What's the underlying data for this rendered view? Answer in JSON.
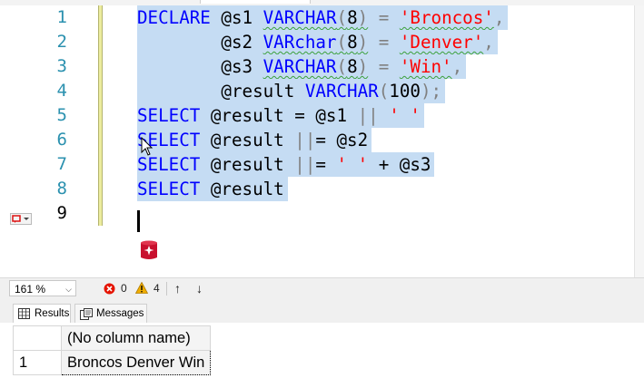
{
  "editor": {
    "lines": [
      {
        "num": "1"
      },
      {
        "num": "2"
      },
      {
        "num": "3"
      },
      {
        "num": "4"
      },
      {
        "num": "5"
      },
      {
        "num": "6"
      },
      {
        "num": "7"
      },
      {
        "num": "8"
      },
      {
        "num": "9"
      }
    ],
    "tokens": {
      "l1": [
        "DECLARE",
        " @s1 ",
        "VARCHAR",
        "(",
        "8",
        ")",
        " = ",
        "'Broncos'",
        ","
      ],
      "l2": [
        "        @s2 ",
        "VARchar",
        "(",
        "8",
        ")",
        " = ",
        "'Denver'",
        ","
      ],
      "l3": [
        "        @s3 ",
        "VARCHAR",
        "(",
        "8",
        ")",
        " = ",
        "'Win'",
        ","
      ],
      "l4": [
        "        @result ",
        "VARCHAR",
        "(",
        "100",
        ")",
        ";"
      ],
      "l5": [
        "SELECT",
        " @result = @s1 ",
        "||",
        " ",
        "' '"
      ],
      "l6": [
        "SELECT",
        " @result ",
        "||",
        "= @s2"
      ],
      "l7": [
        "SELECT",
        " @result ",
        "||",
        "= ",
        "' '",
        " + @s3"
      ],
      "l8": [
        "SELECT",
        " @result"
      ]
    },
    "icons": {
      "bookmark": "comment-bookmark-icon",
      "database": "database-sparkle-icon",
      "cursor": "mouse-pointer-icon"
    },
    "colors": {
      "keyword": "#0000ff",
      "string": "#ff0000",
      "operator": "#808080",
      "line_number": "#2b91af",
      "selection": "#c5dcf3"
    }
  },
  "status": {
    "zoom": "161 %",
    "zoom_arrow": "⌵",
    "errors": "0",
    "warnings": "4",
    "up": "↑",
    "down": "↓"
  },
  "results": {
    "tabs": [
      {
        "label": "Results"
      },
      {
        "label": "Messages"
      }
    ],
    "columns": [
      "(No column name)"
    ],
    "rows": [
      {
        "num": "1",
        "value": "Broncos Denver Win"
      }
    ]
  }
}
